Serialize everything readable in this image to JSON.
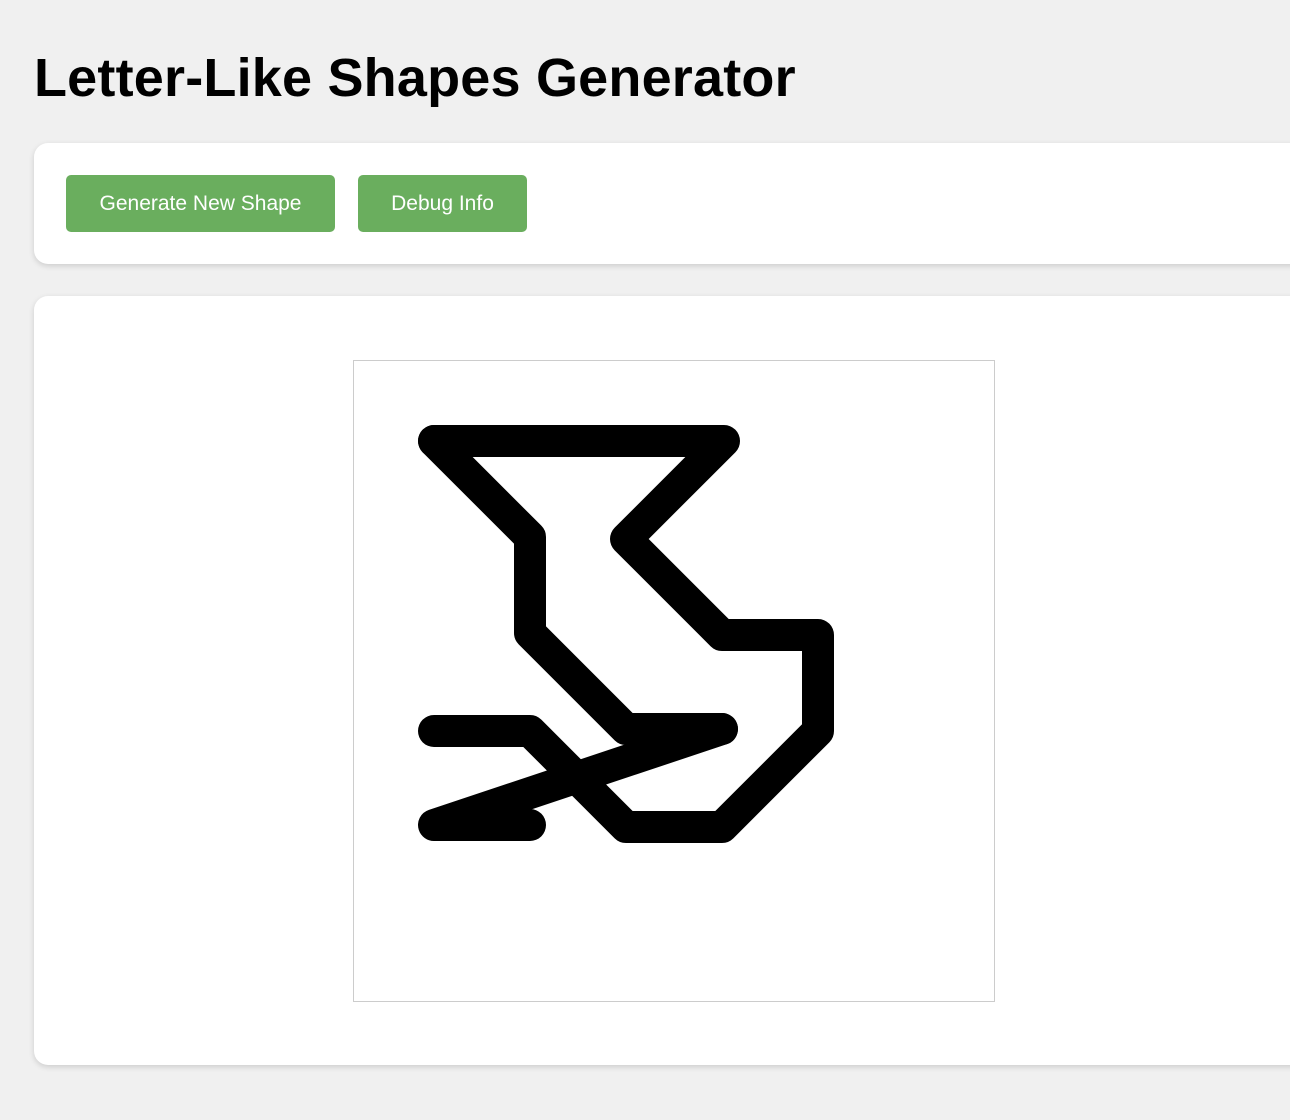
{
  "title": "Letter-Like Shapes Generator",
  "controls": {
    "generate_label": "Generate New Shape",
    "debug_label": "Debug Info"
  },
  "shape": {
    "stroke_color": "#000000",
    "canvas_background": "#ffffff",
    "canvas_border_color": "#cccccc"
  },
  "colors": {
    "page_background": "#f0f0f0",
    "panel_background": "#ffffff",
    "button_background": "#6aae5e",
    "button_text": "#ffffff"
  }
}
